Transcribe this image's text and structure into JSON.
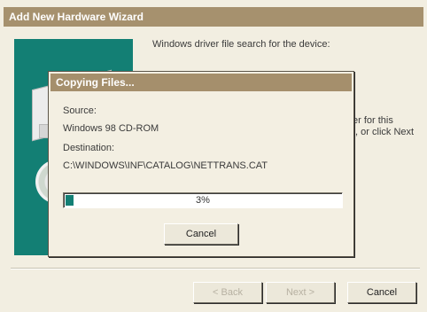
{
  "wizard": {
    "title": "Add New Hardware Wizard",
    "message": "Windows driver file search for the device:",
    "partial_lines": [
      "er for this",
      "., or click Next"
    ],
    "buttons": {
      "back": "< Back",
      "next": "Next >",
      "cancel": "Cancel"
    }
  },
  "copy_dialog": {
    "title": "Copying Files...",
    "source_label": "Source:",
    "source_value": "Windows 98 CD-ROM",
    "destination_label": "Destination:",
    "destination_value": "C:\\WINDOWS\\INF\\CATALOG\\NETTRANS.CAT",
    "progress_text": "3%",
    "progress_value": 3,
    "cancel_label": "Cancel"
  },
  "colors": {
    "title_bar": "#a6916e",
    "accent": "#137f74",
    "window_bg": "#f2eee1"
  }
}
